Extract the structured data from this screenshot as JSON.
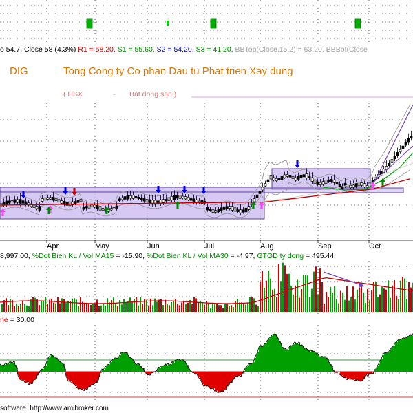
{
  "chart_data": [
    {
      "type": "line",
      "panel": "oscillator-top",
      "series": [],
      "grid": true
    },
    {
      "type": "candlestick",
      "panel": "price",
      "title": "DIG",
      "company_name": "Tong Cong ty Co phan Dau tu Phat trien Xay dung",
      "exchange_label": "( HSX",
      "sector_separator": "-",
      "sector_label": "Bat dong san )",
      "header_segments": [
        {
          "text": "o 54.7, Close 58 (4.3%) ",
          "color": "#000000"
        },
        {
          "text": "R1 = 58.20, ",
          "color": "#d40000"
        },
        {
          "text": "S1 = 55.60, ",
          "color": "#008800"
        },
        {
          "text": "S2 = 54.20, ",
          "color": "#0000c8"
        },
        {
          "text": "S3 = 41.20, ",
          "color": "#008800"
        },
        {
          "text": "BBTop(Close,15,2) = 63.20, ",
          "color": "#a0a0a0"
        },
        {
          "text": "BBBot(Close",
          "color": "#a0a0a0"
        }
      ],
      "x_ticks": [
        "Apr",
        "May",
        "Jun",
        "Jul",
        "Aug",
        "Sep",
        "Oct"
      ],
      "grid": true
    },
    {
      "type": "bar",
      "panel": "volume",
      "header_segments": [
        {
          "text": "8,997.00, ",
          "color": "#000000"
        },
        {
          "text": "%Dot Bien KL / Vol MA15 ",
          "color": "#008800"
        },
        {
          "text": "= -15.90, ",
          "color": "#000000"
        },
        {
          "text": "%Dot Bien KL / Vol MA30 ",
          "color": "#008800"
        },
        {
          "text": "= -4.97, ",
          "color": "#000000"
        },
        {
          "text": "GTGD ty dong ",
          "color": "#008800"
        },
        {
          "text": "= 495.44",
          "color": "#000000"
        }
      ],
      "grid": true
    },
    {
      "type": "area",
      "panel": "oscillator-bottom",
      "header_segments": [
        {
          "text": "ne",
          "color": "#d40000"
        },
        {
          "text": " = 30.00",
          "color": "#000000"
        }
      ],
      "grid": true
    }
  ],
  "footer": {
    "text": "software. http://www.amibroker.com"
  },
  "colors": {
    "up": "#008800",
    "down": "#d40000",
    "box": "#c8b8f0",
    "ma": "#c00000",
    "trend": "#7040c0",
    "band": "#8080ff"
  }
}
